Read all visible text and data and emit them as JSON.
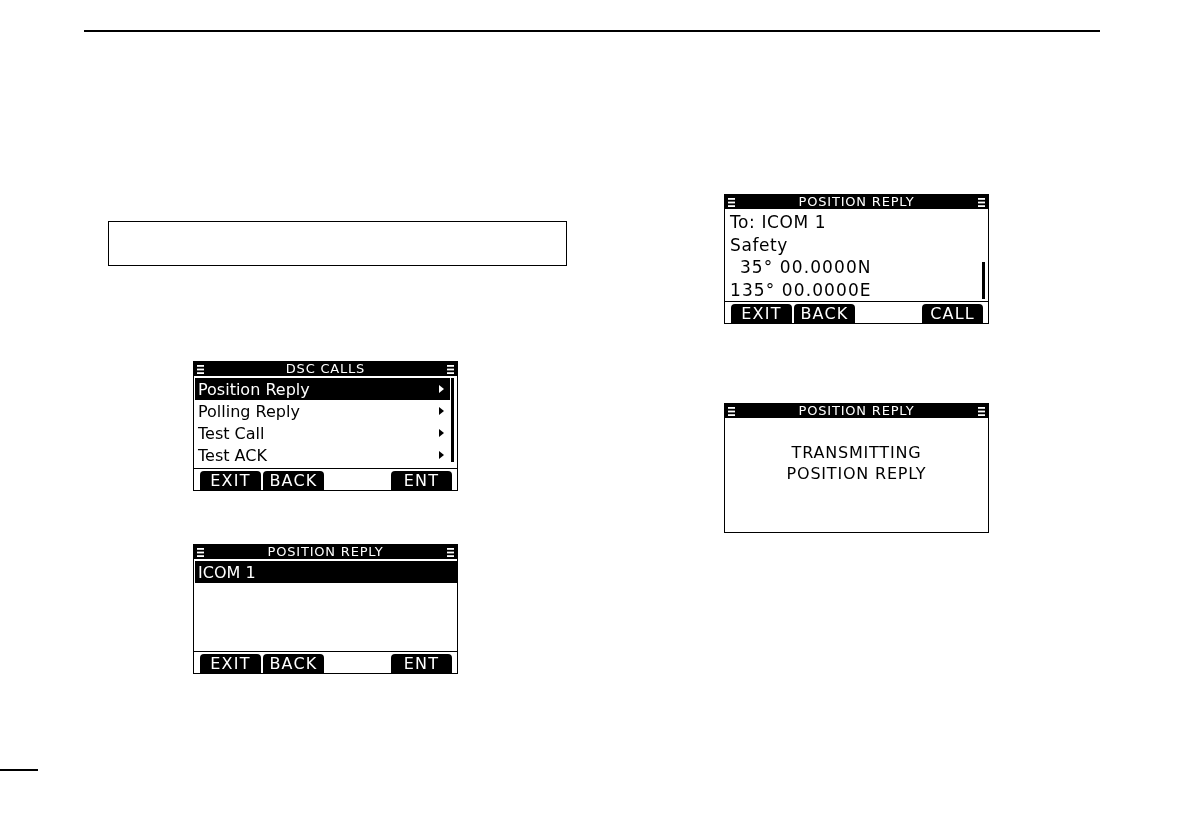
{
  "left_column": {
    "screens": [
      {
        "title": "DSC CALLS",
        "scrollbar": {
          "at_end": false
        },
        "body": {
          "kind": "menu",
          "items": [
            {
              "label": "Position Reply",
              "selected": true,
              "submenu": true
            },
            {
              "label": "Polling Reply",
              "selected": false,
              "submenu": true
            },
            {
              "label": "Test Call",
              "selected": false,
              "submenu": true
            },
            {
              "label": "Test ACK",
              "selected": false,
              "submenu": true
            }
          ]
        },
        "softkeys": {
          "left": [
            "EXIT",
            "BACK"
          ],
          "right": [
            "ENT"
          ]
        }
      },
      {
        "title": "POSITION REPLY",
        "body": {
          "kind": "menu",
          "items": [
            {
              "label": "ICOM 1",
              "selected": true,
              "submenu": false
            }
          ]
        },
        "softkeys": {
          "left": [
            "EXIT",
            "BACK"
          ],
          "right": [
            "ENT"
          ]
        }
      }
    ]
  },
  "right_column": {
    "screens": [
      {
        "title": "POSITION REPLY",
        "scrollbar": {
          "at_end": true
        },
        "body": {
          "kind": "lines",
          "lines": [
            {
              "kind": "plain",
              "text": "To: ICOM 1"
            },
            {
              "kind": "plain",
              "text": "Safety"
            },
            {
              "kind": "coordinate",
              "text": "35° 00.0000N"
            },
            {
              "kind": "coordinate",
              "text": "135° 00.0000E"
            }
          ]
        },
        "softkeys": {
          "left": [
            "EXIT",
            "BACK"
          ],
          "right": [
            "CALL"
          ]
        }
      },
      {
        "title": "POSITION REPLY",
        "body": {
          "kind": "message",
          "lines": [
            "TRANSMITTING",
            "POSITION REPLY"
          ]
        }
      }
    ]
  }
}
